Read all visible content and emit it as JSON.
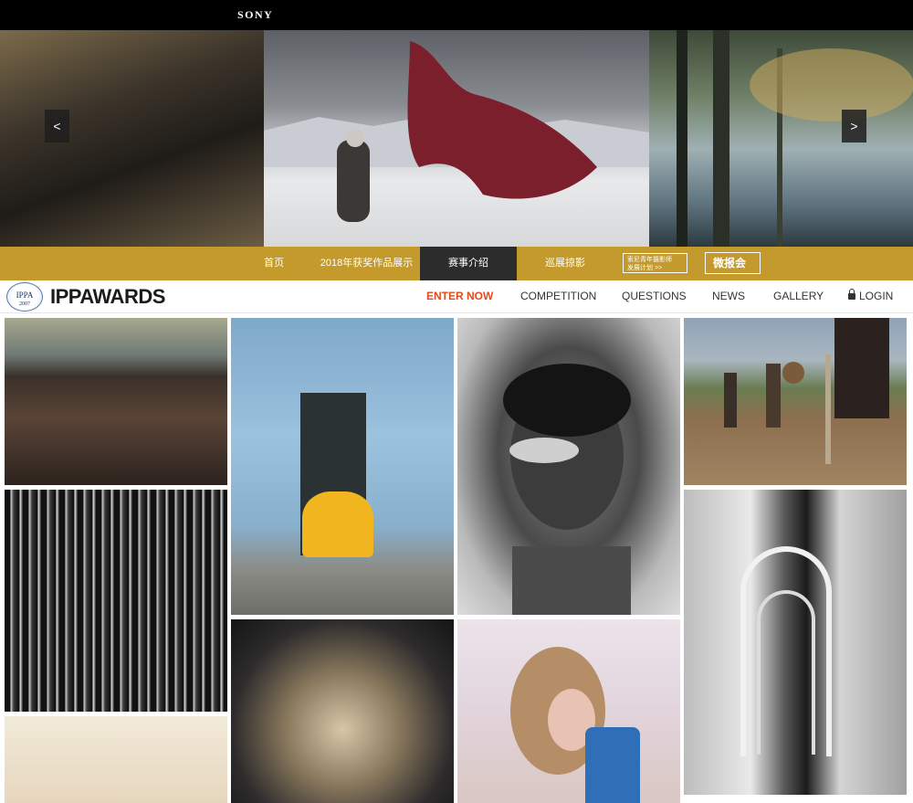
{
  "sony": {
    "brand": "SONY"
  },
  "hero": {
    "prev_arrow": "<",
    "next_arrow": ">"
  },
  "gold_nav": {
    "items": [
      "首页",
      "2018年获奖作品展示",
      "赛事介绍",
      "巡展掠影"
    ],
    "active_index": 2,
    "box_small_line1": "索尼青年摄影师",
    "box_small_line2": "发展计划  >>",
    "box_big": "微报会"
  },
  "ippa": {
    "logo_text": "IPPA",
    "logo_year": "2007",
    "wordmark": "IPPAWARDS",
    "nav": {
      "enter_now": "ENTER NOW",
      "competition": "COMPETITION",
      "questions": "QUESTIONS",
      "news": "NEWS",
      "gallery": "GALLERY",
      "login": "LOGIN"
    }
  },
  "colors": {
    "gold": "#c49a2c",
    "accent": "#e64a19",
    "dark": "#2c2c2c"
  },
  "icons": {
    "lock": "lock-icon"
  }
}
